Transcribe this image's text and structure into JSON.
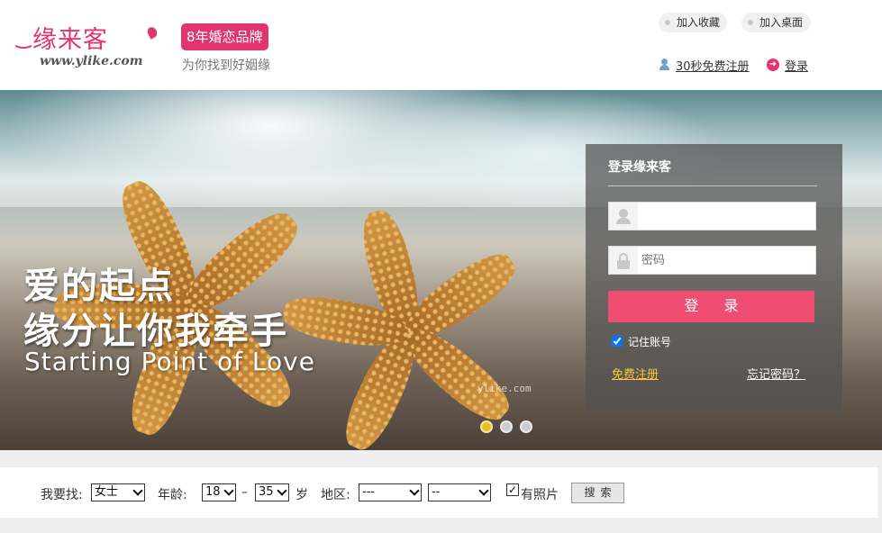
{
  "header": {
    "logo_text": "缘来客",
    "logo_url": "www.ylike.com",
    "brand_badge": "8年婚恋品牌",
    "slogan": "为你找到好姻缘",
    "add_favorite": "加入收藏",
    "add_desktop": "加入桌面",
    "register_link": "30秒免费注册",
    "login_link": "登录"
  },
  "banner": {
    "title_line1": "爱的起点",
    "title_line2": "缘分让你我牵手",
    "subtitle_en": "Starting Point of Love",
    "watermark": "ylike.com",
    "carousel_dots": 3,
    "active_dot": 0
  },
  "login": {
    "title": "登录缘来客",
    "username_value": "",
    "password_placeholder": "密码",
    "submit_label": "登录",
    "remember_label": "记住账号",
    "remember_checked": true,
    "free_register": "免费注册",
    "forgot_password": "忘记密码？"
  },
  "search": {
    "looking_for_label": "我要找:",
    "gender_value": "女士",
    "age_label": "年龄:",
    "age_min": "18",
    "age_sep": "–",
    "age_max": "35",
    "age_unit": "岁",
    "region_label": "地区:",
    "region1_value": "---",
    "region2_value": "--",
    "photo_label": "有照片",
    "photo_checked": true,
    "search_button": "搜索"
  },
  "colors": {
    "brand_pink": "#e2346e",
    "login_button": "#f04d73",
    "register_link_yellow": "#ffc43a",
    "active_dot": "#e8c01f"
  }
}
